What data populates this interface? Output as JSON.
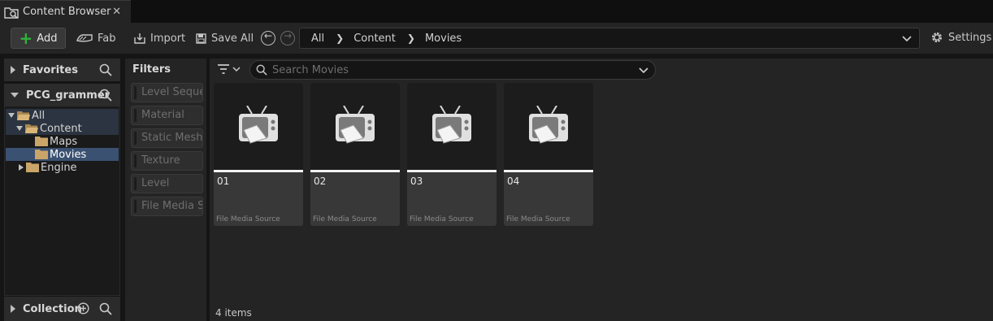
{
  "tab": {
    "title": "Content Browser",
    "close": "✕",
    "icon": "content-browser-icon"
  },
  "toolbar": {
    "add_label": "Add",
    "fab_label": "Fab",
    "import_label": "Import",
    "save_all_label": "Save All",
    "settings_label": "Settings"
  },
  "path": {
    "crumbs": [
      "All",
      "Content",
      "Movies"
    ]
  },
  "favorites": {
    "label": "Favorites"
  },
  "project": {
    "label": "PCG_grammer"
  },
  "tree": {
    "items": [
      {
        "label": "All",
        "state": "expanded"
      },
      {
        "label": "Content",
        "state": "expanded"
      },
      {
        "label": "Maps",
        "state": "leaf"
      },
      {
        "label": "Movies",
        "state": "selected"
      },
      {
        "label": "Engine",
        "state": "collapsed"
      }
    ]
  },
  "collection": {
    "label": "Collection"
  },
  "filters": {
    "title": "Filters",
    "items": [
      "Level Sequencer",
      "Material",
      "Static Mesh",
      "Texture",
      "Level",
      "File Media Source"
    ]
  },
  "search": {
    "placeholder": "Search Movies",
    "value": ""
  },
  "assets": [
    {
      "name": "01",
      "type": "File Media Source"
    },
    {
      "name": "02",
      "type": "File Media Source"
    },
    {
      "name": "03",
      "type": "File Media Source"
    },
    {
      "name": "04",
      "type": "File Media Source"
    }
  ],
  "status": {
    "item_count": "4 items"
  },
  "colors": {
    "selected_row": "#3b5171",
    "add_plus": "#2fb33a",
    "folder": "#c9a56a"
  }
}
